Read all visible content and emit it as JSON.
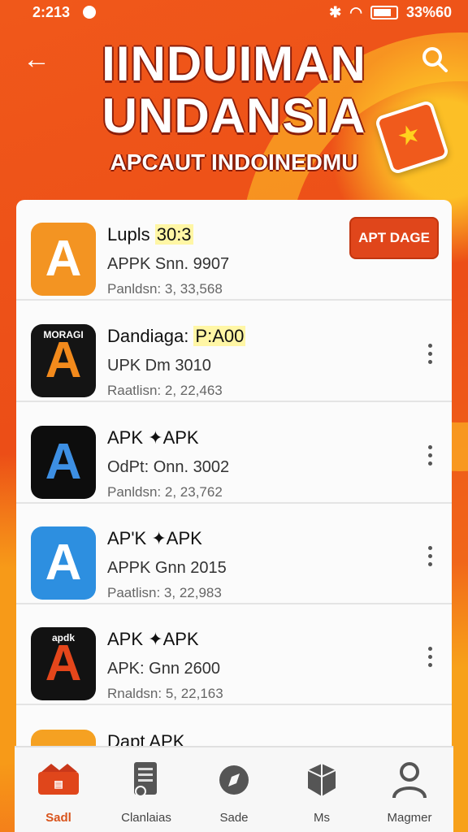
{
  "status": {
    "time": "2:213",
    "battery": "33%60"
  },
  "header": {
    "title_line1": "IINDUIMAN",
    "title_line2": "UNDANSIA",
    "subtitle": "APCAUT INDOINEDMU"
  },
  "apps": [
    {
      "name": "Lupls",
      "name_highlight": "30:3",
      "line2": "APPK Snn. 9907",
      "line3": "Panldsn: 3, 33,568",
      "action": "APT DAGE",
      "icon_bg": "#f39422",
      "icon_fg": "#ffffff",
      "icon_glyph": "A",
      "icon_caption": ""
    },
    {
      "name": "Dandiaga:",
      "name_highlight": "P:A00",
      "line2": "UPK Dm 3010",
      "line3": "Raatlisn: 2, 22,463",
      "icon_bg": "#141414",
      "icon_fg": "#f28a1c",
      "icon_glyph": "A",
      "icon_caption": "MORAGI"
    },
    {
      "name": "APK ✦APK",
      "name_highlight": "",
      "line2": "OdPt: Onn. 3002",
      "line3": "Panldsn: 2, 23,762",
      "icon_bg": "#0d0d0d",
      "icon_fg": "#3d8fe3",
      "icon_glyph": "A",
      "icon_caption": ""
    },
    {
      "name": "AP'K ✦APK",
      "name_highlight": "",
      "line2": "APPK Gnn 2015",
      "line3": "Paatlisn: 3, 22,983",
      "icon_bg": "#2d8fe0",
      "icon_fg": "#ffffff",
      "icon_glyph": "A",
      "icon_caption": ""
    },
    {
      "name": "APK ✦APK",
      "name_highlight": "",
      "line2": "APK: Gnn 2600",
      "line3": "Rnaldsn: 5, 22,163",
      "icon_bg": "#121212",
      "icon_fg": "#e4461b",
      "icon_glyph": "A",
      "icon_caption": "apdk"
    },
    {
      "name": "Dapt APK",
      "name_highlight": "",
      "line2": "",
      "line3": "",
      "icon_bg": "#f5a122",
      "icon_fg": "#ffffff",
      "icon_glyph": "",
      "icon_caption": ""
    }
  ],
  "tabs": [
    {
      "label": "Sadl",
      "active": true
    },
    {
      "label": "Clanlaias",
      "active": false
    },
    {
      "label": "Sade",
      "active": false
    },
    {
      "label": "Ms",
      "active": false
    },
    {
      "label": "Magmer",
      "active": false
    }
  ],
  "colors": {
    "accent": "#e0461b",
    "background": "#ee6a18",
    "card": "#fbfbfb"
  }
}
